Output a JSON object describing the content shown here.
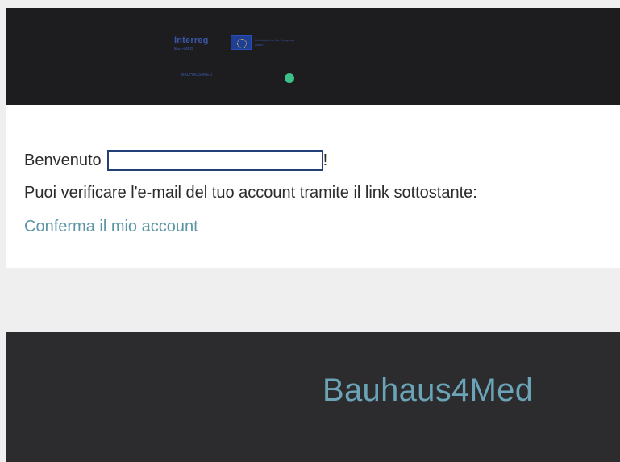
{
  "header": {
    "logo_word": "Interreg",
    "logo_sub": "Euro-MED",
    "eu_text": "Co-funded by the European Union",
    "project_name": "BAUHAUS4MED"
  },
  "content": {
    "welcome_text": "Benvenuto",
    "name_value": "",
    "exclamation": "!",
    "instruction": "Puoi verificare l'e-mail del tuo account tramite il link sottostante:",
    "confirm_link": "Conferma il mio account"
  },
  "footer": {
    "brand": "Bauhaus4Med"
  },
  "colors": {
    "dark_banner": "#1d1d20",
    "footer_bg": "#2c2c2f",
    "link": "#5d95a6",
    "brand": "#6aa4b6",
    "accent_green": "#3cc18a",
    "field_border": "#233f78"
  }
}
